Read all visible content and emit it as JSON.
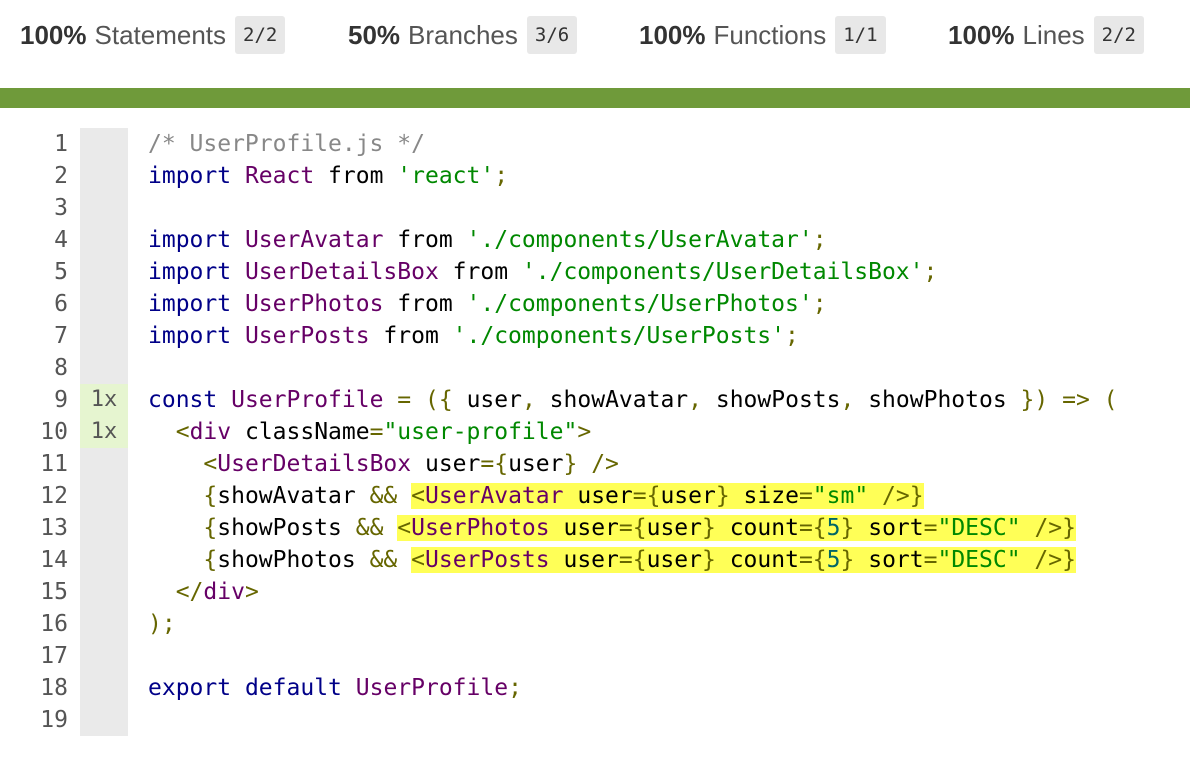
{
  "summary": [
    {
      "percent": "100%",
      "label": "Statements",
      "fraction": "2/2"
    },
    {
      "percent": "50%",
      "label": "Branches",
      "fraction": "3/6"
    },
    {
      "percent": "100%",
      "label": "Functions",
      "fraction": "1/1"
    },
    {
      "percent": "100%",
      "label": "Lines",
      "fraction": "2/2"
    }
  ],
  "colors": {
    "status_bar": "#6f9a3a",
    "covered": "#e6f5d0",
    "neutral": "#eaeaea",
    "uncovered_branch": "#ffff57"
  },
  "lines": [
    {
      "n": "1",
      "hits": "",
      "tokens": [
        [
          "com",
          "/* UserProfile.js */"
        ]
      ]
    },
    {
      "n": "2",
      "hits": "",
      "tokens": [
        [
          "kw",
          "import"
        ],
        [
          "pln",
          " "
        ],
        [
          "id",
          "React"
        ],
        [
          "pln",
          " from "
        ],
        [
          "str",
          "'react'"
        ],
        [
          "pun",
          ";"
        ]
      ]
    },
    {
      "n": "3",
      "hits": "",
      "tokens": []
    },
    {
      "n": "4",
      "hits": "",
      "tokens": [
        [
          "kw",
          "import"
        ],
        [
          "pln",
          " "
        ],
        [
          "id",
          "UserAvatar"
        ],
        [
          "pln",
          " from "
        ],
        [
          "str",
          "'./components/UserAvatar'"
        ],
        [
          "pun",
          ";"
        ]
      ]
    },
    {
      "n": "5",
      "hits": "",
      "tokens": [
        [
          "kw",
          "import"
        ],
        [
          "pln",
          " "
        ],
        [
          "id",
          "UserDetailsBox"
        ],
        [
          "pln",
          " from "
        ],
        [
          "str",
          "'./components/UserDetailsBox'"
        ],
        [
          "pun",
          ";"
        ]
      ]
    },
    {
      "n": "6",
      "hits": "",
      "tokens": [
        [
          "kw",
          "import"
        ],
        [
          "pln",
          " "
        ],
        [
          "id",
          "UserPhotos"
        ],
        [
          "pln",
          " from "
        ],
        [
          "str",
          "'./components/UserPhotos'"
        ],
        [
          "pun",
          ";"
        ]
      ]
    },
    {
      "n": "7",
      "hits": "",
      "tokens": [
        [
          "kw",
          "import"
        ],
        [
          "pln",
          " "
        ],
        [
          "id",
          "UserPosts"
        ],
        [
          "pln",
          " from "
        ],
        [
          "str",
          "'./components/UserPosts'"
        ],
        [
          "pun",
          ";"
        ]
      ]
    },
    {
      "n": "8",
      "hits": "",
      "tokens": []
    },
    {
      "n": "9",
      "hits": "1x",
      "tokens": [
        [
          "kw",
          "const"
        ],
        [
          "pln",
          " "
        ],
        [
          "id",
          "UserProfile"
        ],
        [
          "pln",
          " "
        ],
        [
          "pun",
          "="
        ],
        [
          "pln",
          " "
        ],
        [
          "pun",
          "({"
        ],
        [
          "pln",
          " user"
        ],
        [
          "pun",
          ","
        ],
        [
          "pln",
          " showAvatar"
        ],
        [
          "pun",
          ","
        ],
        [
          "pln",
          " showPosts"
        ],
        [
          "pun",
          ","
        ],
        [
          "pln",
          " showPhotos "
        ],
        [
          "pun",
          "})"
        ],
        [
          "pln",
          " "
        ],
        [
          "pun",
          "=>"
        ],
        [
          "pln",
          " "
        ],
        [
          "pun",
          "("
        ]
      ]
    },
    {
      "n": "10",
      "hits": "1x",
      "tokens": [
        [
          "pln",
          "  "
        ],
        [
          "pun",
          "<"
        ],
        [
          "tag",
          "div"
        ],
        [
          "pln",
          " "
        ],
        [
          "atn",
          "className"
        ],
        [
          "pun",
          "="
        ],
        [
          "atv",
          "\"user-profile\""
        ],
        [
          "pun",
          ">"
        ]
      ]
    },
    {
      "n": "11",
      "hits": "",
      "tokens": [
        [
          "pln",
          "    "
        ],
        [
          "pun",
          "<"
        ],
        [
          "tag",
          "UserDetailsBox"
        ],
        [
          "pln",
          " "
        ],
        [
          "atn",
          "user"
        ],
        [
          "pun",
          "={"
        ],
        [
          "pln",
          "user"
        ],
        [
          "pun",
          "}"
        ],
        [
          "pln",
          " "
        ],
        [
          "pun",
          "/>"
        ]
      ]
    },
    {
      "n": "12",
      "hits": "",
      "tokens": [
        [
          "pln",
          "    "
        ],
        [
          "pun",
          "{"
        ],
        [
          "pln",
          "showAvatar "
        ],
        [
          "pun",
          "&&"
        ],
        [
          "pln",
          " "
        ],
        [
          "hl",
          [
            [
              "pun",
              "<"
            ],
            [
              "tag",
              "UserAvatar"
            ],
            [
              "pln",
              " "
            ],
            [
              "atn",
              "user"
            ],
            [
              "pun",
              "={"
            ],
            [
              "pln",
              "user"
            ],
            [
              "pun",
              "}"
            ],
            [
              "pln",
              " "
            ],
            [
              "atn",
              "size"
            ],
            [
              "pun",
              "="
            ],
            [
              "atv",
              "\"sm\""
            ],
            [
              "pln",
              " "
            ],
            [
              "pun",
              "/>}"
            ]
          ]
        ]
      ]
    },
    {
      "n": "13",
      "hits": "",
      "tokens": [
        [
          "pln",
          "    "
        ],
        [
          "pun",
          "{"
        ],
        [
          "pln",
          "showPosts "
        ],
        [
          "pun",
          "&&"
        ],
        [
          "pln",
          " "
        ],
        [
          "hl",
          [
            [
              "pun",
              "<"
            ],
            [
              "tag",
              "UserPhotos"
            ],
            [
              "pln",
              " "
            ],
            [
              "atn",
              "user"
            ],
            [
              "pun",
              "={"
            ],
            [
              "pln",
              "user"
            ],
            [
              "pun",
              "}"
            ],
            [
              "pln",
              " "
            ],
            [
              "atn",
              "count"
            ],
            [
              "pun",
              "={"
            ],
            [
              "num",
              "5"
            ],
            [
              "pun",
              "}"
            ],
            [
              "pln",
              " "
            ],
            [
              "atn",
              "sort"
            ],
            [
              "pun",
              "="
            ],
            [
              "atv",
              "\"DESC\""
            ],
            [
              "pln",
              " "
            ],
            [
              "pun",
              "/>}"
            ]
          ]
        ]
      ]
    },
    {
      "n": "14",
      "hits": "",
      "tokens": [
        [
          "pln",
          "    "
        ],
        [
          "pun",
          "{"
        ],
        [
          "pln",
          "showPhotos "
        ],
        [
          "pun",
          "&&"
        ],
        [
          "pln",
          " "
        ],
        [
          "hl",
          [
            [
              "pun",
              "<"
            ],
            [
              "tag",
              "UserPosts"
            ],
            [
              "pln",
              " "
            ],
            [
              "atn",
              "user"
            ],
            [
              "pun",
              "={"
            ],
            [
              "pln",
              "user"
            ],
            [
              "pun",
              "}"
            ],
            [
              "pln",
              " "
            ],
            [
              "atn",
              "count"
            ],
            [
              "pun",
              "={"
            ],
            [
              "num",
              "5"
            ],
            [
              "pun",
              "}"
            ],
            [
              "pln",
              " "
            ],
            [
              "atn",
              "sort"
            ],
            [
              "pun",
              "="
            ],
            [
              "atv",
              "\"DESC\""
            ],
            [
              "pln",
              " "
            ],
            [
              "pun",
              "/>}"
            ]
          ]
        ]
      ]
    },
    {
      "n": "15",
      "hits": "",
      "tokens": [
        [
          "pln",
          "  "
        ],
        [
          "pun",
          "</"
        ],
        [
          "tag",
          "div"
        ],
        [
          "pun",
          ">"
        ]
      ]
    },
    {
      "n": "16",
      "hits": "",
      "tokens": [
        [
          "pun",
          ");"
        ]
      ]
    },
    {
      "n": "17",
      "hits": "",
      "tokens": []
    },
    {
      "n": "18",
      "hits": "",
      "tokens": [
        [
          "kw",
          "export"
        ],
        [
          "pln",
          " "
        ],
        [
          "kw",
          "default"
        ],
        [
          "pln",
          " "
        ],
        [
          "id",
          "UserProfile"
        ],
        [
          "pun",
          ";"
        ]
      ]
    },
    {
      "n": "19",
      "hits": "",
      "tokens": []
    }
  ]
}
